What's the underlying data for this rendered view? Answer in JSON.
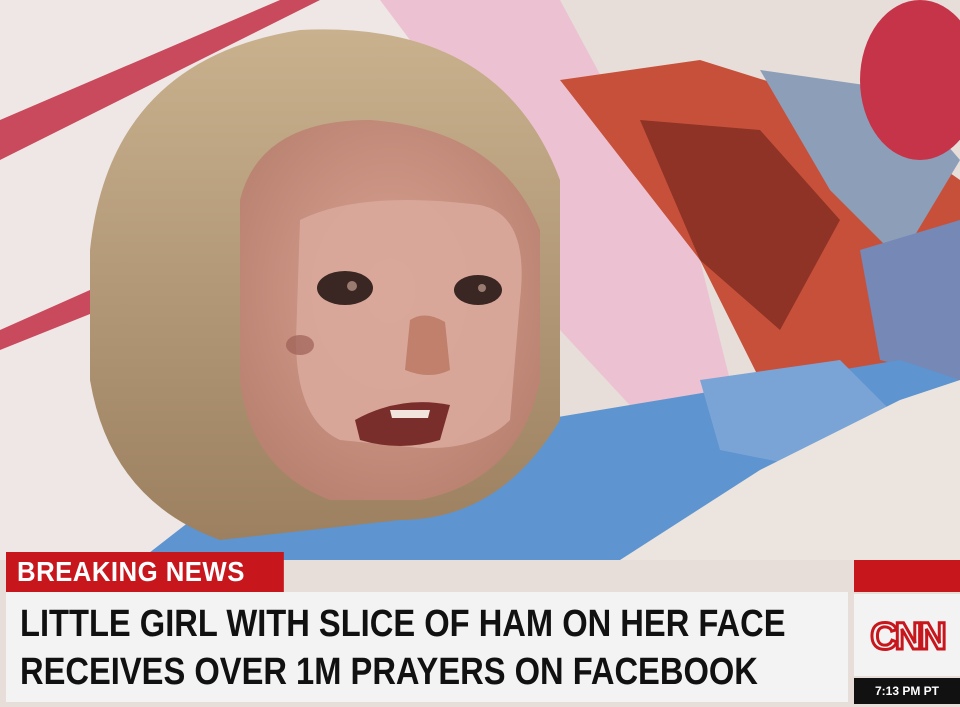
{
  "chyron": {
    "breaking_label": "BREAKING NEWS",
    "headline_line1": "LITTLE GIRL WITH SLICE OF HAM ON HER FACE",
    "headline_line2": "RECEIVES OVER 1M PRAYERS ON FACEBOOK",
    "network_logo_text": "CNN",
    "timestamp": "7:13 PM PT"
  },
  "colors": {
    "accent_red": "#c8161d",
    "chyron_bg": "#f3f3f3",
    "headline_text": "#111111"
  }
}
